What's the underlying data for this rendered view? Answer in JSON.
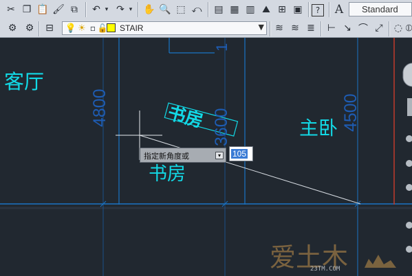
{
  "toolbar_top": {
    "icons": [
      "cut-icon",
      "copy-icon",
      "paste-icon",
      "match-properties-icon",
      "block-editor-icon",
      "undo-icon",
      "redo-icon",
      "pan-icon",
      "zoom-realtime-icon",
      "zoom-window-icon",
      "zoom-previous-icon",
      "properties-icon",
      "design-center-icon",
      "tool-palettes-icon",
      "sheet-set-icon",
      "markup-icon",
      "quickcalc-icon",
      "help-icon",
      "text-style-icon"
    ],
    "text_style": "Standard"
  },
  "toolbar_layers": {
    "current_layer": "STAIR"
  },
  "drawing": {
    "rooms": {
      "living": "客厅",
      "study_rotated": "书房",
      "study": "书房",
      "master": "主卧"
    },
    "dimensions": {
      "d4800": "4800",
      "d4500": "4500",
      "d3600": "3600",
      "top_partial": "1"
    }
  },
  "command": {
    "prompt": "指定新角度或",
    "input_value": "105"
  },
  "watermark": {
    "text": "爱土木",
    "url": "23TM.COM"
  },
  "colors": {
    "background": "#212830",
    "cyan_text": "#12d9e6",
    "blue_line": "#1a74c6",
    "red_line": "#c23a2b",
    "dim_text": "#1e5cb3"
  }
}
